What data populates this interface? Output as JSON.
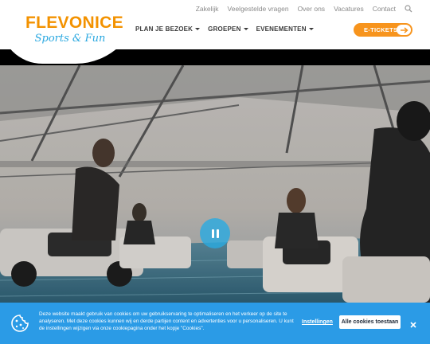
{
  "brand": {
    "name": "FLEVONICE",
    "tagline": "Sports & Fun",
    "orange": "#f39200",
    "blue": "#2aa8e0"
  },
  "topnav": {
    "items": [
      "Zakelijk",
      "Veelgestelde vragen",
      "Over ons",
      "Vacatures",
      "Contact"
    ],
    "search_icon": "search-icon"
  },
  "mainnav": {
    "items": [
      "PLAN JE BEZOEK",
      "GROEPEN",
      "EVENEMENTEN"
    ]
  },
  "cta": {
    "label": "E-TICKETS",
    "icon": "arrow-right-icon",
    "color": "#f7941d"
  },
  "hero": {
    "media": "video",
    "state": "playing",
    "control_icon": "pause-icon"
  },
  "cookie": {
    "text": "Deze website maakt gebruik van cookies om uw gebruikservaring te optimaliseren en het verkeer op de site te analyseren. Met deze cookies kunnen wij en derde partijen content en advertenties voor u personaliseren. U kunt de instellingen wijzigen via onze cookiepagina onder het kopje \"Cookies\".",
    "settings_label": "Instellingen",
    "accept_label": "Alle cookies toestaan",
    "icon": "cookie-icon",
    "close_icon": "close-icon",
    "background": "#2b9be6"
  }
}
